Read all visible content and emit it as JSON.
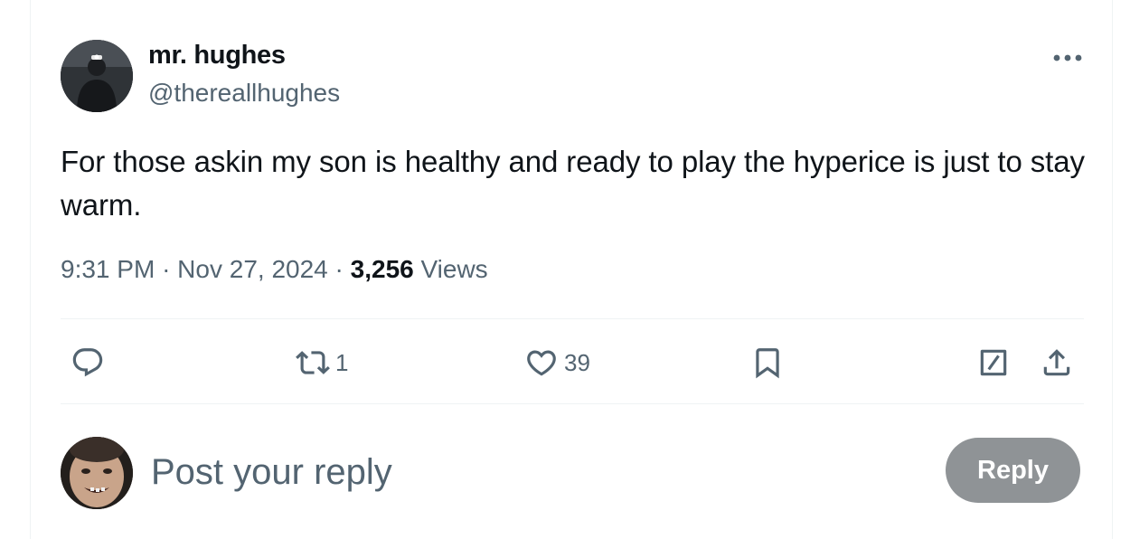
{
  "author": {
    "display_name": "mr. hughes",
    "handle": "@thereallhughes"
  },
  "menu": {
    "more_icon": "more-horizontal-icon"
  },
  "tweet": {
    "text": "For those askin my son is healthy and ready to play the hyperice is just to stay warm."
  },
  "meta": {
    "time": "9:31 PM",
    "separator": "·",
    "date": "Nov 27, 2024",
    "views_count": "3,256",
    "views_label": "Views"
  },
  "actions": {
    "reply": {
      "icon": "reply-bubble-icon",
      "count": ""
    },
    "repost": {
      "icon": "repost-icon",
      "count": "1"
    },
    "like": {
      "icon": "heart-icon",
      "count": "39"
    },
    "bookmark": {
      "icon": "bookmark-icon"
    },
    "edit": {
      "icon": "edit-icon"
    },
    "share": {
      "icon": "share-upload-icon"
    }
  },
  "composer": {
    "placeholder": "Post your reply",
    "button_label": "Reply"
  },
  "colors": {
    "text_primary": "#0f1419",
    "text_secondary": "#536471",
    "divider": "#eff3f4",
    "reply_button_disabled": "#8f9396"
  }
}
